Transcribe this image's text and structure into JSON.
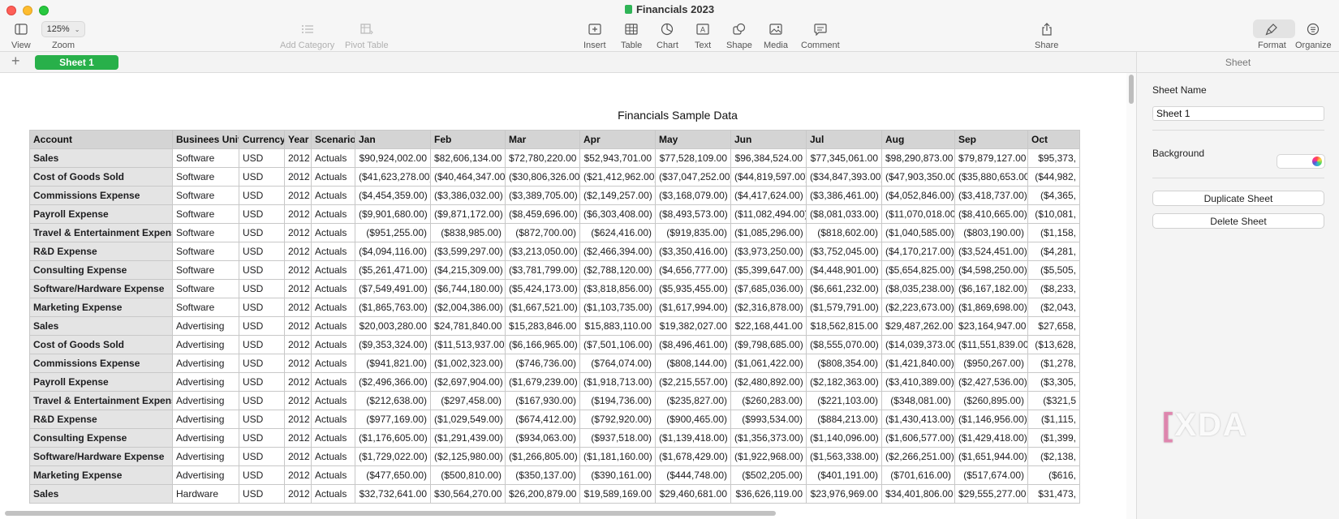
{
  "window": {
    "title": "Financials 2023"
  },
  "toolbar": {
    "view_label": "View",
    "zoom_value": "125%",
    "zoom_label": "Zoom",
    "add_category_label": "Add Category",
    "pivot_table_label": "Pivot Table",
    "insert_label": "Insert",
    "table_label": "Table",
    "chart_label": "Chart",
    "text_label": "Text",
    "shape_label": "Shape",
    "media_label": "Media",
    "comment_label": "Comment",
    "share_label": "Share",
    "format_label": "Format",
    "organize_label": "Organize"
  },
  "tabs": {
    "add": "+",
    "sheet_name": "Sheet 1"
  },
  "table": {
    "title": "Financials Sample Data",
    "headers": [
      "Account",
      "Businees Unit",
      "Currency",
      "Year",
      "Scenario",
      "Jan",
      "Feb",
      "Mar",
      "Apr",
      "May",
      "Jun",
      "Jul",
      "Aug",
      "Sep",
      "Oct"
    ],
    "rows": [
      [
        "Sales",
        "Software",
        "USD",
        "2012",
        "Actuals",
        "$90,924,002.00",
        "$82,606,134.00",
        "$72,780,220.00",
        "$52,943,701.00",
        "$77,528,109.00",
        "$96,384,524.00",
        "$77,345,061.00",
        "$98,290,873.00",
        "$79,879,127.00",
        "$95,373,"
      ],
      [
        "Cost of Goods Sold",
        "Software",
        "USD",
        "2012",
        "Actuals",
        "($41,623,278.00)",
        "($40,464,347.00)",
        "($30,806,326.00)",
        "($21,412,962.00)",
        "($37,047,252.00)",
        "($44,819,597.00)",
        "($34,847,393.00)",
        "($47,903,350.00)",
        "($35,880,653.00)",
        "($44,982,"
      ],
      [
        "Commissions Expense",
        "Software",
        "USD",
        "2012",
        "Actuals",
        "($4,454,359.00)",
        "($3,386,032.00)",
        "($3,389,705.00)",
        "($2,149,257.00)",
        "($3,168,079.00)",
        "($4,417,624.00)",
        "($3,386,461.00)",
        "($4,052,846.00)",
        "($3,418,737.00)",
        "($4,365,"
      ],
      [
        "Payroll Expense",
        "Software",
        "USD",
        "2012",
        "Actuals",
        "($9,901,680.00)",
        "($9,871,172.00)",
        "($8,459,696.00)",
        "($6,303,408.00)",
        "($8,493,573.00)",
        "($11,082,494.00)",
        "($8,081,033.00)",
        "($11,070,018.00)",
        "($8,410,665.00)",
        "($10,081,"
      ],
      [
        "Travel & Entertainment Expense",
        "Software",
        "USD",
        "2012",
        "Actuals",
        "($951,255.00)",
        "($838,985.00)",
        "($872,700.00)",
        "($624,416.00)",
        "($919,835.00)",
        "($1,085,296.00)",
        "($818,602.00)",
        "($1,040,585.00)",
        "($803,190.00)",
        "($1,158,"
      ],
      [
        "R&D Expense",
        "Software",
        "USD",
        "2012",
        "Actuals",
        "($4,094,116.00)",
        "($3,599,297.00)",
        "($3,213,050.00)",
        "($2,466,394.00)",
        "($3,350,416.00)",
        "($3,973,250.00)",
        "($3,752,045.00)",
        "($4,170,217.00)",
        "($3,524,451.00)",
        "($4,281,"
      ],
      [
        "Consulting Expense",
        "Software",
        "USD",
        "2012",
        "Actuals",
        "($5,261,471.00)",
        "($4,215,309.00)",
        "($3,781,799.00)",
        "($2,788,120.00)",
        "($4,656,777.00)",
        "($5,399,647.00)",
        "($4,448,901.00)",
        "($5,654,825.00)",
        "($4,598,250.00)",
        "($5,505,"
      ],
      [
        "Software/Hardware Expense",
        "Software",
        "USD",
        "2012",
        "Actuals",
        "($7,549,491.00)",
        "($6,744,180.00)",
        "($5,424,173.00)",
        "($3,818,856.00)",
        "($5,935,455.00)",
        "($7,685,036.00)",
        "($6,661,232.00)",
        "($8,035,238.00)",
        "($6,167,182.00)",
        "($8,233,"
      ],
      [
        "Marketing Expense",
        "Software",
        "USD",
        "2012",
        "Actuals",
        "($1,865,763.00)",
        "($2,004,386.00)",
        "($1,667,521.00)",
        "($1,103,735.00)",
        "($1,617,994.00)",
        "($2,316,878.00)",
        "($1,579,791.00)",
        "($2,223,673.00)",
        "($1,869,698.00)",
        "($2,043,"
      ],
      [
        "Sales",
        "Advertising",
        "USD",
        "2012",
        "Actuals",
        "$20,003,280.00",
        "$24,781,840.00",
        "$15,283,846.00",
        "$15,883,110.00",
        "$19,382,027.00",
        "$22,168,441.00",
        "$18,562,815.00",
        "$29,487,262.00",
        "$23,164,947.00",
        "$27,658,"
      ],
      [
        "Cost of Goods Sold",
        "Advertising",
        "USD",
        "2012",
        "Actuals",
        "($9,353,324.00)",
        "($11,513,937.00)",
        "($6,166,965.00)",
        "($7,501,106.00)",
        "($8,496,461.00)",
        "($9,798,685.00)",
        "($8,555,070.00)",
        "($14,039,373.00)",
        "($11,551,839.00)",
        "($13,628,"
      ],
      [
        "Commissions Expense",
        "Advertising",
        "USD",
        "2012",
        "Actuals",
        "($941,821.00)",
        "($1,002,323.00)",
        "($746,736.00)",
        "($764,074.00)",
        "($808,144.00)",
        "($1,061,422.00)",
        "($808,354.00)",
        "($1,421,840.00)",
        "($950,267.00)",
        "($1,278,"
      ],
      [
        "Payroll Expense",
        "Advertising",
        "USD",
        "2012",
        "Actuals",
        "($2,496,366.00)",
        "($2,697,904.00)",
        "($1,679,239.00)",
        "($1,918,713.00)",
        "($2,215,557.00)",
        "($2,480,892.00)",
        "($2,182,363.00)",
        "($3,410,389.00)",
        "($2,427,536.00)",
        "($3,305,"
      ],
      [
        "Travel & Entertainment Expense",
        "Advertising",
        "USD",
        "2012",
        "Actuals",
        "($212,638.00)",
        "($297,458.00)",
        "($167,930.00)",
        "($194,736.00)",
        "($235,827.00)",
        "($260,283.00)",
        "($221,103.00)",
        "($348,081.00)",
        "($260,895.00)",
        "($321,5"
      ],
      [
        "R&D Expense",
        "Advertising",
        "USD",
        "2012",
        "Actuals",
        "($977,169.00)",
        "($1,029,549.00)",
        "($674,412.00)",
        "($792,920.00)",
        "($900,465.00)",
        "($993,534.00)",
        "($884,213.00)",
        "($1,430,413.00)",
        "($1,146,956.00)",
        "($1,115,"
      ],
      [
        "Consulting Expense",
        "Advertising",
        "USD",
        "2012",
        "Actuals",
        "($1,176,605.00)",
        "($1,291,439.00)",
        "($934,063.00)",
        "($937,518.00)",
        "($1,139,418.00)",
        "($1,356,373.00)",
        "($1,140,096.00)",
        "($1,606,577.00)",
        "($1,429,418.00)",
        "($1,399,"
      ],
      [
        "Software/Hardware Expense",
        "Advertising",
        "USD",
        "2012",
        "Actuals",
        "($1,729,022.00)",
        "($2,125,980.00)",
        "($1,266,805.00)",
        "($1,181,160.00)",
        "($1,678,429.00)",
        "($1,922,968.00)",
        "($1,563,338.00)",
        "($2,266,251.00)",
        "($1,651,944.00)",
        "($2,138,"
      ],
      [
        "Marketing Expense",
        "Advertising",
        "USD",
        "2012",
        "Actuals",
        "($477,650.00)",
        "($500,810.00)",
        "($350,137.00)",
        "($390,161.00)",
        "($444,748.00)",
        "($502,205.00)",
        "($401,191.00)",
        "($701,616.00)",
        "($517,674.00)",
        "($616,"
      ],
      [
        "Sales",
        "Hardware",
        "USD",
        "2012",
        "Actuals",
        "$32,732,641.00",
        "$30,564,270.00",
        "$26,200,879.00",
        "$19,589,169.00",
        "$29,460,681.00",
        "$36,626,119.00",
        "$23,976,969.00",
        "$34,401,806.00",
        "$29,555,277.00",
        "$31,473,"
      ]
    ]
  },
  "inspector": {
    "header": "Sheet",
    "sheet_name_label": "Sheet Name",
    "sheet_name_value": "Sheet 1",
    "background_label": "Background",
    "duplicate_label": "Duplicate Sheet",
    "delete_label": "Delete Sheet"
  },
  "watermark": "XDA",
  "colors": {
    "accent_green": "#28b04a",
    "header_gray": "#d4d4d4",
    "account_gray": "#e4e4e4"
  }
}
